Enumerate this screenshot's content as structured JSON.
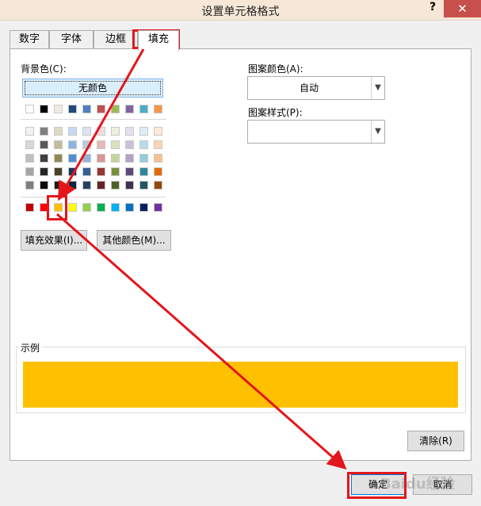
{
  "window": {
    "title": "设置单元格格式",
    "help": "?",
    "close": "✕"
  },
  "tabs": [
    {
      "label": "数字"
    },
    {
      "label": "字体"
    },
    {
      "label": "边框"
    },
    {
      "label": "填充"
    }
  ],
  "fill": {
    "background_label": "背景色(C):",
    "no_color_label": "无颜色",
    "fill_effects_label": "填充效果(I)...",
    "more_colors_label": "其他颜色(M)...",
    "pattern_color_label": "图案颜色(A):",
    "pattern_color_value": "自动",
    "pattern_style_label": "图案样式(P):",
    "pattern_style_value": "",
    "sample_label": "示例",
    "sample_color": "#FFC000",
    "clear_label": "清除(R)",
    "selected_color": "#FFC000"
  },
  "palette": {
    "theme_top": [
      "#FFFFFF",
      "#000000",
      "#EEECE1",
      "#1F497D",
      "#4F81BD",
      "#C0504D",
      "#9BBB59",
      "#8064A2",
      "#4BACC6",
      "#F79646"
    ],
    "theme_shades": [
      [
        "#F2F2F2",
        "#7F7F7F",
        "#DDD9C3",
        "#C6D9F0",
        "#DBE5F1",
        "#F2DCDB",
        "#EBF1DD",
        "#E5E0EC",
        "#DBEEF3",
        "#FDEADA"
      ],
      [
        "#D8D8D8",
        "#595959",
        "#C4BD97",
        "#8DB3E2",
        "#B8CCE4",
        "#E5B9B7",
        "#D7E3BC",
        "#CCC1D9",
        "#B7DDE8",
        "#FBD5B5"
      ],
      [
        "#BFBFBF",
        "#3F3F3F",
        "#938953",
        "#548DD4",
        "#95B3D7",
        "#D99694",
        "#C3D69B",
        "#B2A2C7",
        "#92CDDC",
        "#FAC08F"
      ],
      [
        "#A5A5A5",
        "#262626",
        "#494429",
        "#17365D",
        "#366092",
        "#953734",
        "#76923C",
        "#5F497A",
        "#31859B",
        "#E36C09"
      ],
      [
        "#7F7F7F",
        "#0C0C0C",
        "#1D1B10",
        "#0F243E",
        "#244061",
        "#632423",
        "#4F6128",
        "#3F3151",
        "#205867",
        "#974806"
      ]
    ],
    "standard": [
      "#C00000",
      "#FF0000",
      "#FFC000",
      "#FFFF00",
      "#92D050",
      "#00B050",
      "#00B0F0",
      "#0070C0",
      "#002060",
      "#7030A0"
    ]
  },
  "footer": {
    "ok_label": "确定",
    "cancel_label": "取消"
  },
  "annotation": {
    "color": "#E3161B"
  },
  "watermark": "Baidu经验"
}
